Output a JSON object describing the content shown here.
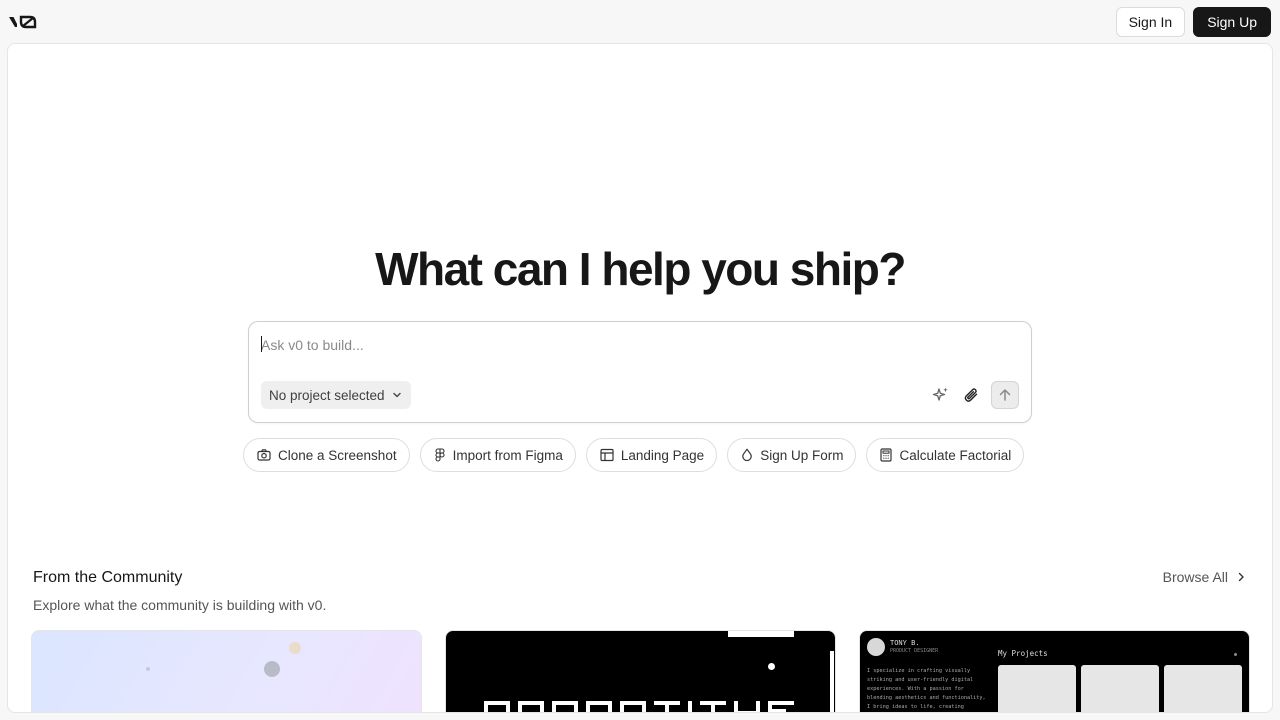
{
  "header": {
    "logo_label": "v0",
    "sign_in_label": "Sign In",
    "sign_up_label": "Sign Up"
  },
  "hero": {
    "title": "What can I help you ship?"
  },
  "prompt": {
    "placeholder": "Ask v0 to build...",
    "value": "",
    "project_select_label": "No project selected",
    "icons": [
      "sparkles-icon",
      "paperclip-icon",
      "arrow-up-icon"
    ]
  },
  "suggestions": [
    {
      "label": "Clone a Screenshot",
      "icon": "camera-icon"
    },
    {
      "label": "Import from Figma",
      "icon": "figma-icon"
    },
    {
      "label": "Landing Page",
      "icon": "layout-icon"
    },
    {
      "label": "Sign Up Form",
      "icon": "droplet-icon"
    },
    {
      "label": "Calculate Factorial",
      "icon": "calculator-icon"
    }
  ],
  "community": {
    "title": "From the Community",
    "subtitle": "Explore what the community is building with v0.",
    "browse_all_label": "Browse All",
    "cards": [
      {
        "theme": "gradient"
      },
      {
        "theme": "dark"
      },
      {
        "theme": "portfolio",
        "name": "TONY B.",
        "role": "PRODUCT DESIGNER",
        "section": "My Projects",
        "bio": "I specialize in crafting visually striking and user-friendly digital experiences. With a passion for blending aesthetics and functionality, I bring ideas to life, creating innovative solutions in the dynamic world of web design."
      }
    ]
  },
  "colors": {
    "primary": "#171717",
    "page_bg": "#f7f7f7",
    "panel_bg": "#ffffff",
    "border": "#e5e5e5"
  }
}
